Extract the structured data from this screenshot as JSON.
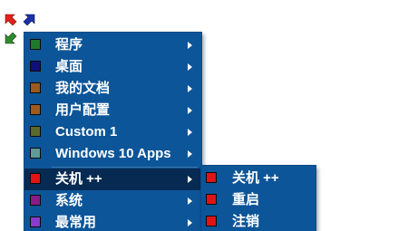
{
  "app_icon": {
    "name": "four-arrows-icon",
    "colors": [
      "#e0221b",
      "#1b2fa8",
      "#2e8b2e",
      "#e8a020"
    ]
  },
  "main_menu": {
    "items": [
      {
        "label": "程序",
        "color": "#1f7a2e",
        "has_submenu": true
      },
      {
        "label": "桌面",
        "color": "#10107a",
        "has_submenu": true
      },
      {
        "label": "我的文档",
        "color": "#9a5a1e",
        "has_submenu": true
      },
      {
        "label": "用户配置",
        "color": "#a05a1a",
        "has_submenu": true
      },
      {
        "label": "Custom 1",
        "color": "#5a6a2a",
        "has_submenu": true
      },
      {
        "label": "Windows 10 Apps",
        "color": "#5e9a96",
        "has_submenu": true
      },
      {
        "label": "关机 ++",
        "color": "#e01414",
        "has_submenu": true,
        "active": true
      },
      {
        "label": "系统",
        "color": "#8a1a8a",
        "has_submenu": true
      },
      {
        "label": "最常用",
        "color": "#8a3ad0",
        "has_submenu": true
      }
    ]
  },
  "sub_menu": {
    "items": [
      {
        "label": "关机 ++",
        "color": "#e01414"
      },
      {
        "label": "重启",
        "color": "#e01414"
      },
      {
        "label": "注销",
        "color": "#e01414"
      }
    ]
  }
}
